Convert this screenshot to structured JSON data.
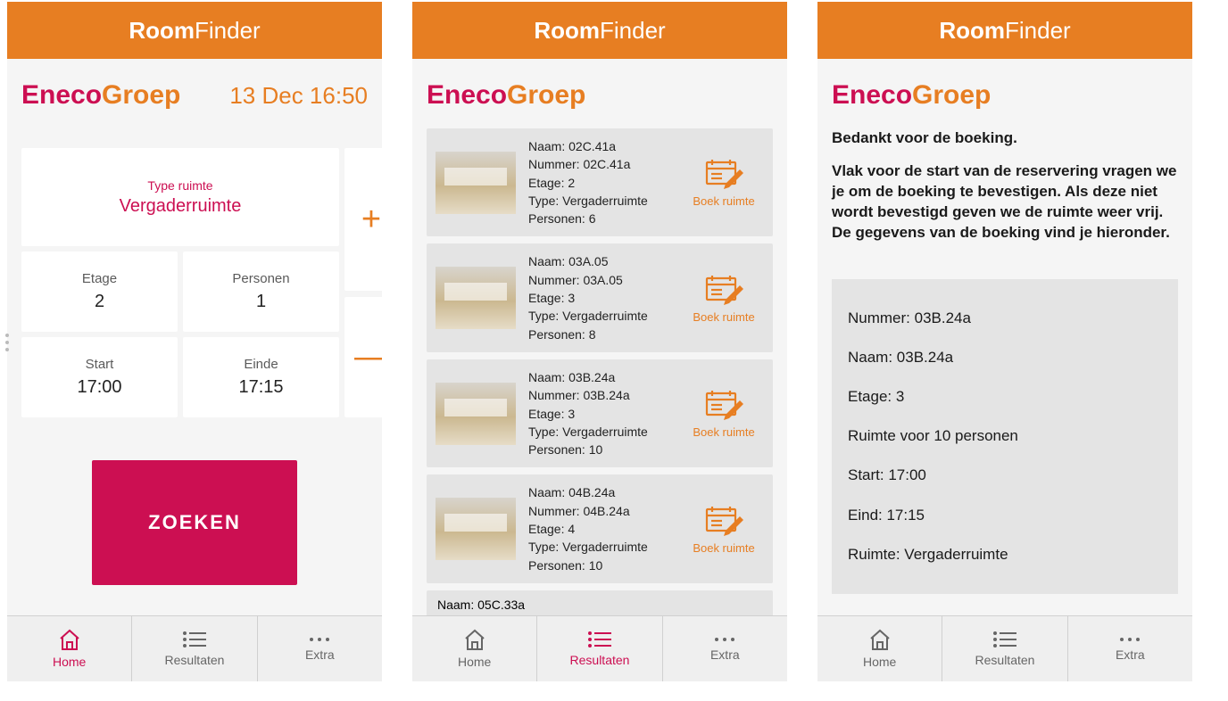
{
  "header": {
    "title_bold": "Room",
    "title_light": "Finder"
  },
  "brand": {
    "part1": "Eneco",
    "part2": "Groep"
  },
  "nav": {
    "home": "Home",
    "results": "Resultaten",
    "extra": "Extra"
  },
  "screen1": {
    "date": "13 Dec 16:50",
    "type_label": "Type ruimte",
    "type_value": "Vergaderruimte",
    "etage_label": "Etage",
    "etage_value": "2",
    "pers_label": "Personen",
    "pers_value": "1",
    "start_label": "Start",
    "start_value": "17:00",
    "end_label": "Einde",
    "end_value": "17:15",
    "search": "ZOEKEN"
  },
  "screen2": {
    "labels": {
      "naam": "Naam",
      "nummer": "Nummer",
      "etage": "Etage",
      "type": "Type",
      "personen": "Personen"
    },
    "book_label": "Boek ruimte",
    "rooms": [
      {
        "naam": "02C.41a",
        "nummer": "02C.41a",
        "etage": "2",
        "type": "Vergaderruimte",
        "personen": "6"
      },
      {
        "naam": "03A.05",
        "nummer": "03A.05",
        "etage": "3",
        "type": "Vergaderruimte",
        "personen": "8"
      },
      {
        "naam": "03B.24a",
        "nummer": "03B.24a",
        "etage": "3",
        "type": "Vergaderruimte",
        "personen": "10"
      },
      {
        "naam": "04B.24a",
        "nummer": "04B.24a",
        "etage": "4",
        "type": "Vergaderruimte",
        "personen": "10"
      }
    ],
    "partial": {
      "naam": "05C.33a"
    }
  },
  "screen3": {
    "line1": "Bedankt voor de boeking.",
    "line2": "Vlak voor de start van de reservering vragen we je om de boeking te bevestigen. Als deze niet wordt bevestigd geven we de ruimte weer vrij. De gegevens van de boeking vind je hieronder.",
    "summary": {
      "nummer": "Nummer: 03B.24a",
      "naam": "Naam: 03B.24a",
      "etage": "Etage: 3",
      "capaciteit": "Ruimte voor 10 personen",
      "start": "Start: 17:00",
      "eind": "Eind: 17:15",
      "ruimte": "Ruimte: Vergaderruimte"
    }
  }
}
